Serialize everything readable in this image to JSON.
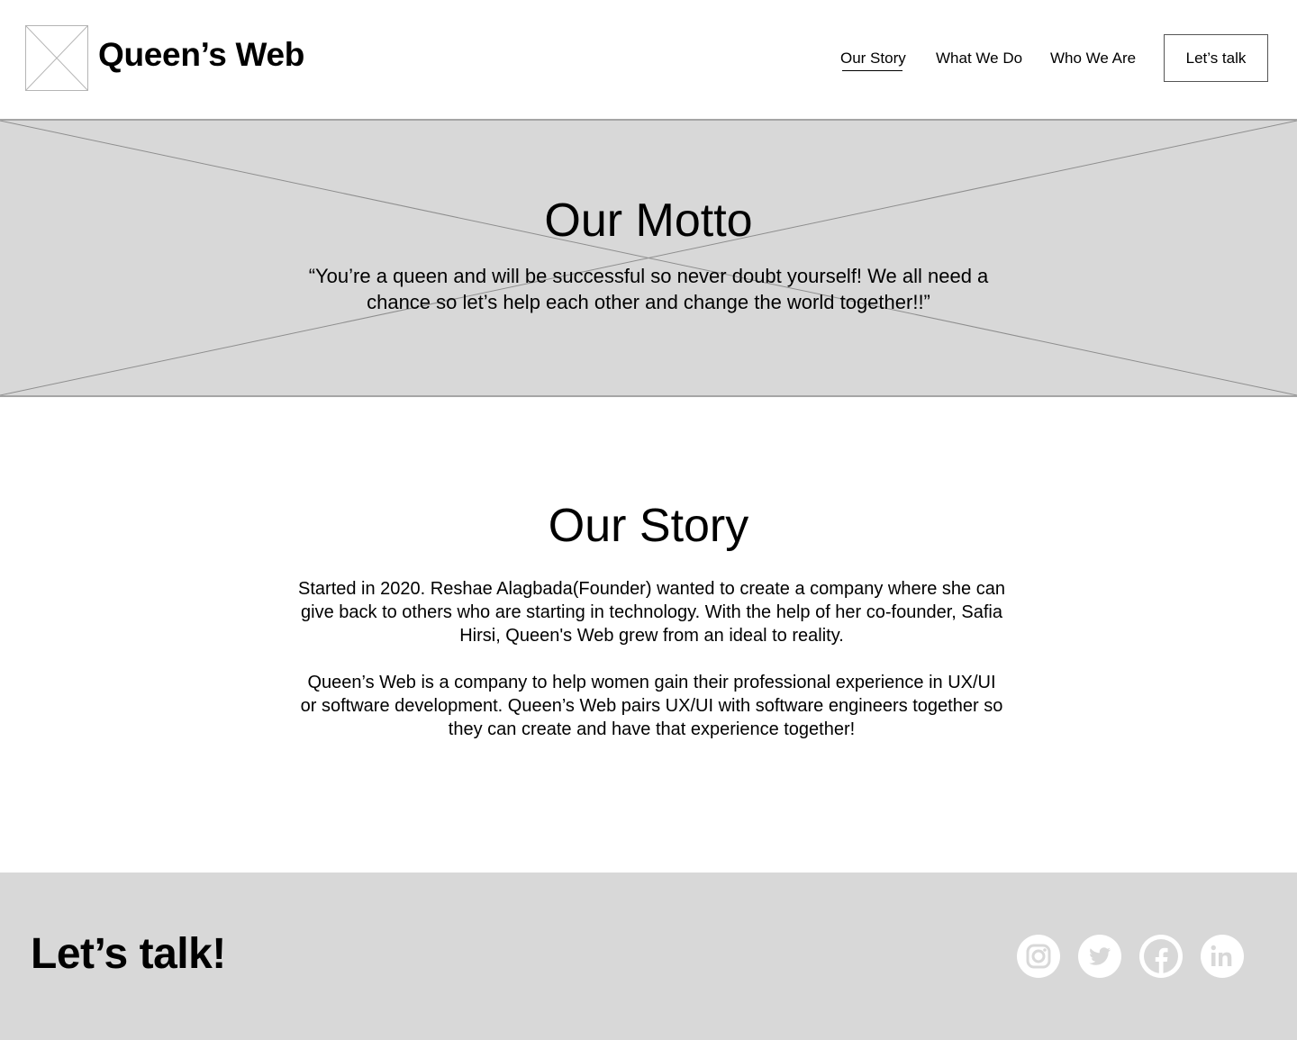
{
  "header": {
    "brand": "Queen’s Web",
    "nav": [
      {
        "label": "Our Story",
        "active": true
      },
      {
        "label": "What We Do",
        "active": false
      },
      {
        "label": "Who We Are",
        "active": false
      }
    ],
    "cta_label": "Let’s talk"
  },
  "hero": {
    "title": "Our Motto",
    "quote": "“You’re a queen and will be successful so never doubt yourself! We all need a chance so let’s help each other and change the world together!!”",
    "background": "#d8d8d8"
  },
  "story": {
    "title": "Our Story",
    "paragraphs": [
      "Started in 2020. Reshae Alagbada(Founder) wanted to create a company where she can give back to others who are starting in technology. With the help of her co-founder, Safia Hirsi, Queen's Web grew from an ideal to reality.",
      "Queen’s Web is a company to help women gain their professional experience in UX/UI or software development. Queen’s Web pairs UX/UI with software engineers together so they can create and have that experience together!"
    ]
  },
  "footer": {
    "title": "Let’s talk!",
    "background": "#d8d8d8",
    "social": [
      {
        "icon": "instagram-icon"
      },
      {
        "icon": "twitter-icon"
      },
      {
        "icon": "facebook-icon"
      },
      {
        "icon": "linkedin-icon"
      }
    ]
  },
  "colors": {
    "placeholder_gray": "#d8d8d8",
    "text": "#000000",
    "icon_fill": "#d8d8d8",
    "icon_bg": "#ffffff"
  }
}
